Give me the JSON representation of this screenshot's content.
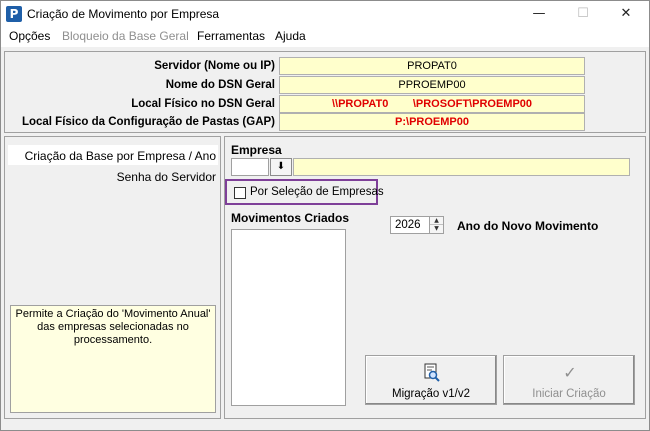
{
  "window": {
    "title": "Criação de Movimento por Empresa",
    "app_icon_letter": "P",
    "minimize_glyph": "—",
    "maximize_glyph": "☐",
    "close_glyph": "✕"
  },
  "menu": {
    "items": [
      {
        "label": "Opções",
        "enabled": true
      },
      {
        "label": "Bloqueio da Base Geral",
        "enabled": false
      },
      {
        "label": "Ferramentas",
        "enabled": true
      },
      {
        "label": "Ajuda",
        "enabled": true
      }
    ]
  },
  "server_info": {
    "rows": [
      {
        "label": "Servidor (Nome ou IP)",
        "value": "PROPAT0"
      },
      {
        "label": "Nome do DSN Geral",
        "value": "PPROEMP00"
      },
      {
        "label": "Local Físico no DSN Geral",
        "value": "\\\\PROPAT0        \\PROSOFT\\PROEMP00"
      },
      {
        "label": "Local Físico da Configuração de Pastas (GAP)",
        "value": "P:\\PROEMP00"
      }
    ],
    "value_bg_color": "#ffffcc",
    "path_color": "#e00000"
  },
  "nav": {
    "items": [
      {
        "label": "Criação da Base por Empresa / Ano",
        "selected": true
      },
      {
        "label": "Senha do Servidor",
        "selected": false
      }
    ]
  },
  "help_text": "Permite a Criação do 'Movimento Anual' das empresas selecionadas no processamento.",
  "form": {
    "empresa_label": "Empresa",
    "empresa_code": "",
    "empresa_name": "",
    "lookup_icon": "arrow-down-icon",
    "lookup_glyph": "⬇",
    "selection_checkbox_label": "Por Seleção de Empresas",
    "selection_checkbox_checked": false,
    "highlight_color": "#7e3f98",
    "movimentos_label": "Movimentos Criados",
    "year_value": "2026",
    "year_label": "Ano do Novo Movimento",
    "spin_up_glyph": "▲",
    "spin_down_glyph": "▼"
  },
  "buttons": {
    "migracao": {
      "label": "Migração v1/v2",
      "icon": "document-search-icon",
      "glyph": "🔍",
      "enabled": true
    },
    "iniciar": {
      "label": "Iniciar Criação",
      "icon": "checkmark-icon",
      "glyph": "✓",
      "enabled": false
    }
  }
}
